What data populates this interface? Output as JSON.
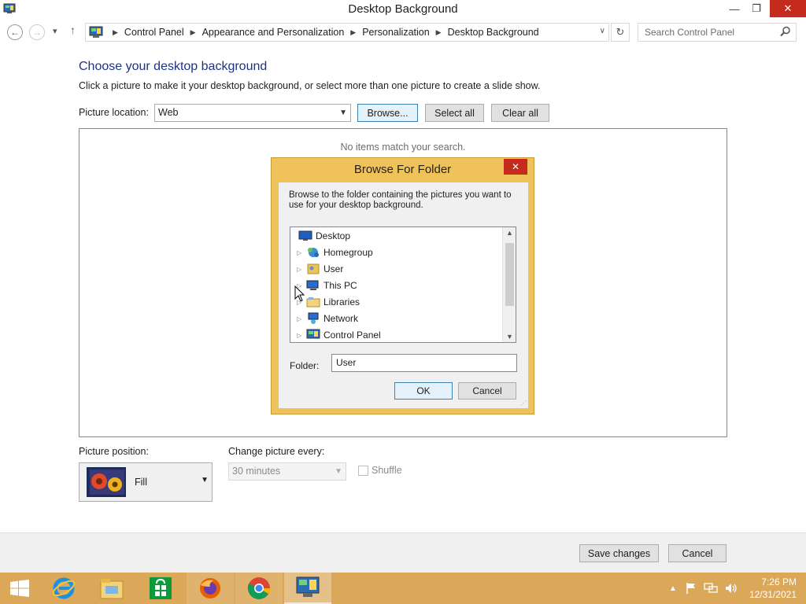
{
  "window": {
    "title": "Desktop Background",
    "minimize": "—",
    "restore": "❐",
    "close": "✕"
  },
  "nav": {
    "back": "←",
    "forward": "→",
    "recent": "▾",
    "up": "↑",
    "breadcrumbs": [
      "Control Panel",
      "Appearance and Personalization",
      "Personalization",
      "Desktop Background"
    ],
    "address_dropdown": "∨",
    "refresh": "↻",
    "search_placeholder": "Search Control Panel"
  },
  "main": {
    "heading": "Choose your desktop background",
    "instruction": "Click a picture to make it your desktop background, or select more than one picture to create a slide show.",
    "picture_location_label": "Picture location:",
    "picture_location_value": "Web",
    "browse_label": "Browse...",
    "select_all_label": "Select all",
    "clear_all_label": "Clear all",
    "empty_message": "No items match your search."
  },
  "dialog": {
    "title": "Browse For Folder",
    "close": "✕",
    "description": "Browse to the folder containing the pictures you want to use for your desktop background.",
    "tree": [
      {
        "label": "Desktop",
        "icon": "desktop-icon",
        "expandable": false
      },
      {
        "label": "Homegroup",
        "icon": "homegroup-icon",
        "expandable": true
      },
      {
        "label": "User",
        "icon": "user-folder-icon",
        "expandable": true
      },
      {
        "label": "This PC",
        "icon": "this-pc-icon",
        "expandable": true
      },
      {
        "label": "Libraries",
        "icon": "libraries-icon",
        "expandable": true
      },
      {
        "label": "Network",
        "icon": "network-icon",
        "expandable": true
      },
      {
        "label": "Control Panel",
        "icon": "control-panel-icon",
        "expandable": true
      }
    ],
    "folder_label": "Folder:",
    "folder_value": "User",
    "ok_label": "OK",
    "cancel_label": "Cancel"
  },
  "options": {
    "position_label": "Picture position:",
    "position_value": "Fill",
    "change_label": "Change picture every:",
    "change_value": "30 minutes",
    "shuffle_label": "Shuffle",
    "shuffle_checked": false
  },
  "footer": {
    "save_label": "Save changes",
    "cancel_label": "Cancel"
  },
  "taskbar": {
    "apps": [
      "start-icon",
      "internet-explorer-icon",
      "file-explorer-icon",
      "store-icon",
      "firefox-icon",
      "chrome-icon",
      "control-panel-icon"
    ],
    "time": "7:26 PM",
    "date": "12/31/2021"
  },
  "colors": {
    "accent_heading": "#1e3287",
    "taskbar": "#dba85a",
    "dialog_frame": "#f0c35a",
    "close_red": "#c42b1c"
  }
}
